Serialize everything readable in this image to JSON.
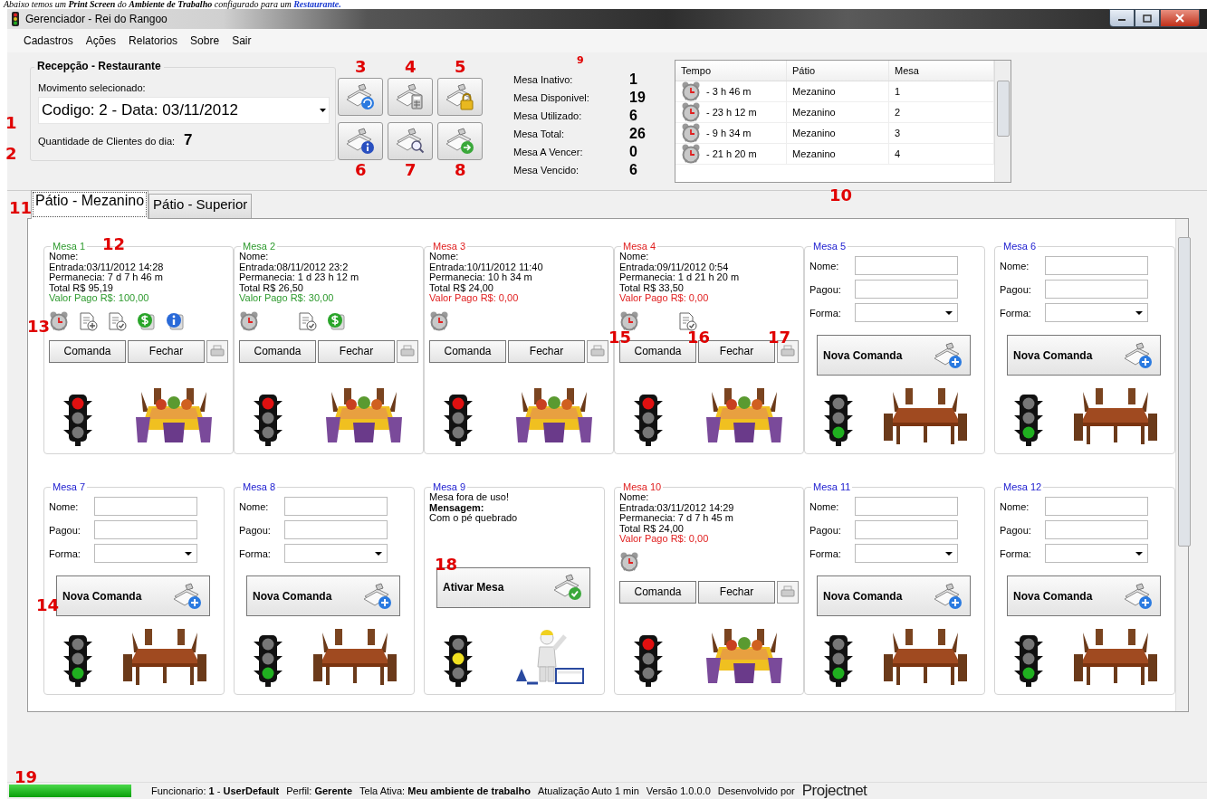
{
  "caption": {
    "text": "Abaixo temos um **Print Screen** do **Ambiente de Trabalho** configurado para um",
    "link": "Restaurante."
  },
  "window": {
    "title": "Gerenciador - Rei do Rangoo"
  },
  "menu": [
    "Cadastros",
    "Ações",
    "Relatorios",
    "Sobre",
    "Sair"
  ],
  "reception": {
    "title": "Recepção - Restaurante",
    "movement_label": "Movimento selecionado:",
    "movement_value": "Codigo: 2 - Data: 03/11/2012",
    "movement_callout": "1",
    "clients_label": "Quantidade de Clientes do dia:",
    "clients_value": "7",
    "clients_callout": "2"
  },
  "tool_buttons": [
    {
      "kind": "refresh",
      "callout": "3"
    },
    {
      "kind": "calculator",
      "callout": "4"
    },
    {
      "kind": "lock",
      "callout": "5"
    },
    {
      "kind": "info",
      "callout": "6"
    },
    {
      "kind": "search",
      "callout": "7"
    },
    {
      "kind": "forward",
      "callout": "8"
    }
  ],
  "stats": {
    "callout": "9",
    "items": [
      {
        "label": "Mesa Inativo:",
        "value": "1"
      },
      {
        "label": "Mesa Disponivel:",
        "value": "19"
      },
      {
        "label": "Mesa Utilizado:",
        "value": "6"
      },
      {
        "label": "Mesa Total:",
        "value": "26"
      },
      {
        "label": "Mesa A Vencer:",
        "value": "0"
      },
      {
        "label": "Mesa Vencido:",
        "value": "6"
      }
    ]
  },
  "timers_table": {
    "callout": "10",
    "columns": [
      "Tempo",
      "Pátio",
      "Mesa"
    ],
    "rows": [
      {
        "tempo": "- 3 h 46 m",
        "patio": "Mezanino",
        "mesa": "1"
      },
      {
        "tempo": "- 23 h 12 m",
        "patio": "Mezanino",
        "mesa": "2"
      },
      {
        "tempo": "- 9 h 34 m",
        "patio": "Mezanino",
        "mesa": "3"
      },
      {
        "tempo": "- 21 h 20 m",
        "patio": "Mezanino",
        "mesa": "4"
      }
    ]
  },
  "tabs": {
    "callout": "11",
    "items": [
      {
        "label": "Pátio - Mezanino",
        "selected": true
      },
      {
        "label": "Pátio - Superior",
        "selected": false
      }
    ]
  },
  "tables": [
    {
      "kind": "occupied",
      "title": "Mesa 1",
      "title_callout": "12",
      "color": "#e01010",
      "lines": [
        "Nome:",
        "Entrada:03/11/2012 14:28",
        "Permanecia: 7 d 7 h 46 m",
        "Total R$ 95,19"
      ],
      "payment": "Valor Pago R$: 100,00",
      "paid": true,
      "icons": {
        "alarm": true,
        "add_item": true,
        "check_item": true,
        "money": true,
        "info": true
      },
      "icons_callout": "13",
      "buttons": [
        {
          "label": "Comanda"
        },
        {
          "label": "Fechar"
        }
      ]
    },
    {
      "kind": "occupied",
      "title": "Mesa 2",
      "color": "#e01010",
      "lines": [
        "Nome:",
        "Entrada:08/11/2012 23:2",
        "Permanecia: 1 d 23 h 12 m",
        "Total R$ 26,50"
      ],
      "payment": "Valor Pago R$: 30,00",
      "paid": true,
      "icons": {
        "alarm": true,
        "add_item": false,
        "check_item": true,
        "money": true,
        "info": false
      },
      "buttons": [
        {
          "label": "Comanda"
        },
        {
          "label": "Fechar"
        }
      ]
    },
    {
      "kind": "occupied",
      "title": "Mesa 3",
      "color": "#e01010",
      "lines": [
        "Nome:",
        "Entrada:10/11/2012 11:40",
        "Permanecia: 10 h 34 m",
        "Total R$ 24,00"
      ],
      "payment": "Valor Pago R$: 0,00",
      "paid": false,
      "icons": {
        "alarm": true,
        "add_item": false,
        "check_item": false,
        "money": false,
        "info": false
      },
      "buttons": [
        {
          "label": "Comanda"
        },
        {
          "label": "Fechar"
        }
      ]
    },
    {
      "kind": "occupied",
      "title": "Mesa 4",
      "color": "#e01010",
      "lines": [
        "Nome:",
        "Entrada:09/11/2012 0:54",
        "Permanecia: 1 d 21 h 20 m",
        "Total R$ 33,50"
      ],
      "payment": "Valor Pago R$: 0,00",
      "paid": false,
      "icons": {
        "alarm": true,
        "add_item": false,
        "check_item": true,
        "money": false,
        "info": false
      },
      "buttons": [
        {
          "label": "Comanda",
          "callout": "15"
        },
        {
          "label": "Fechar",
          "callout": "16"
        }
      ],
      "print_callout": "17"
    },
    {
      "kind": "free",
      "title": "Mesa 5",
      "color": "#20b020",
      "fields": [
        {
          "label": "Nome:",
          "kind": "text"
        },
        {
          "label": "Pagou:",
          "kind": "text"
        },
        {
          "label": "Forma:",
          "kind": "select"
        }
      ],
      "action": "Nova Comanda"
    },
    {
      "kind": "free",
      "title": "Mesa 6",
      "color": "#20b020",
      "fields": [
        {
          "label": "Nome:",
          "kind": "text"
        },
        {
          "label": "Pagou:",
          "kind": "text"
        },
        {
          "label": "Forma:",
          "kind": "select"
        }
      ],
      "action": "Nova Comanda"
    },
    {
      "kind": "free",
      "title": "Mesa 7",
      "color": "#20b020",
      "fields": [
        {
          "label": "Nome:",
          "kind": "text"
        },
        {
          "label": "Pagou:",
          "kind": "text"
        },
        {
          "label": "Forma:",
          "kind": "select"
        }
      ],
      "action": "Nova Comanda",
      "action_callout": "14"
    },
    {
      "kind": "free",
      "title": "Mesa 8",
      "color": "#20b020",
      "fields": [
        {
          "label": "Nome:",
          "kind": "text"
        },
        {
          "label": "Pagou:",
          "kind": "text"
        },
        {
          "label": "Forma:",
          "kind": "select"
        }
      ],
      "action": "Nova Comanda"
    },
    {
      "kind": "inactive",
      "title": "Mesa 9",
      "color": "#f0e020",
      "status": "Mesa fora de uso!",
      "message_label": "Mensagem:",
      "message": "Com o pé quebrado",
      "action": "Ativar Mesa",
      "action_callout": "18"
    },
    {
      "kind": "occupied",
      "title": "Mesa 10",
      "color": "#e01010",
      "lines": [
        "Nome:",
        "Entrada:03/11/2012 14:29",
        "Permanecia: 7 d 7 h 45 m",
        "Total R$ 24,00"
      ],
      "payment": "Valor Pago R$: 0,00",
      "paid": false,
      "icons": {
        "alarm": true,
        "add_item": false,
        "check_item": false,
        "money": false,
        "info": false
      },
      "buttons": [
        {
          "label": "Comanda"
        },
        {
          "label": "Fechar"
        }
      ]
    },
    {
      "kind": "free",
      "title": "Mesa 11",
      "color": "#20b020",
      "fields": [
        {
          "label": "Nome:",
          "kind": "text"
        },
        {
          "label": "Pagou:",
          "kind": "text"
        },
        {
          "label": "Forma:",
          "kind": "select"
        }
      ],
      "action": "Nova Comanda"
    },
    {
      "kind": "free",
      "title": "Mesa 12",
      "color": "#20b020",
      "fields": [
        {
          "label": "Nome:",
          "kind": "text"
        },
        {
          "label": "Pagou:",
          "kind": "text"
        },
        {
          "label": "Forma:",
          "kind": "select"
        }
      ],
      "action": "Nova Comanda"
    }
  ],
  "status_bar": {
    "callout": "19",
    "level": 1,
    "items": [
      "Funcionario: **1** - **UserDefault**",
      "Perfil: **Gerente**",
      "Tela Ativa: **Meu ambiente de trabalho**",
      "Atualização Auto 1 min",
      "Versão 1.0.0.0",
      "Desenvolvido por"
    ],
    "logo": "**Project**net"
  }
}
